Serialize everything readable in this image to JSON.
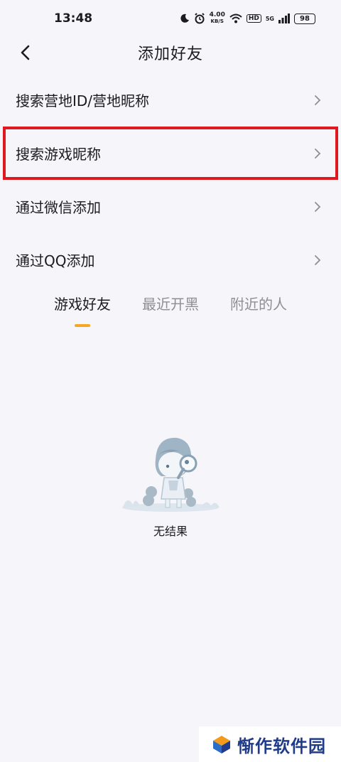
{
  "status": {
    "time": "13:48",
    "net_speed_value": "4.00",
    "net_speed_unit": "KB/S",
    "hd": "HD",
    "network": "5G",
    "battery": "98",
    "icons": [
      "moon-icon",
      "alarm-icon",
      "wifi-icon",
      "signal-icon",
      "battery-icon"
    ]
  },
  "nav": {
    "title": "添加好友",
    "back_icon": "chevron-left-icon"
  },
  "menu": {
    "items": [
      {
        "label": "搜索营地ID/营地昵称"
      },
      {
        "label": "搜索游戏昵称"
      },
      {
        "label": "通过微信添加"
      },
      {
        "label": "通过QQ添加"
      }
    ]
  },
  "tabs": {
    "items": [
      {
        "label": "游戏好友",
        "active": true
      },
      {
        "label": "最近开黑",
        "active": false
      },
      {
        "label": "附近的人",
        "active": false
      }
    ],
    "indicator_color": "#f5a623"
  },
  "empty": {
    "text": "无结果",
    "illustration": "girl-with-magnifier-illustration"
  },
  "watermark": {
    "text": "惭作软件园"
  },
  "colors": {
    "highlight": "#e0191e",
    "background": "#f5f5fa"
  }
}
